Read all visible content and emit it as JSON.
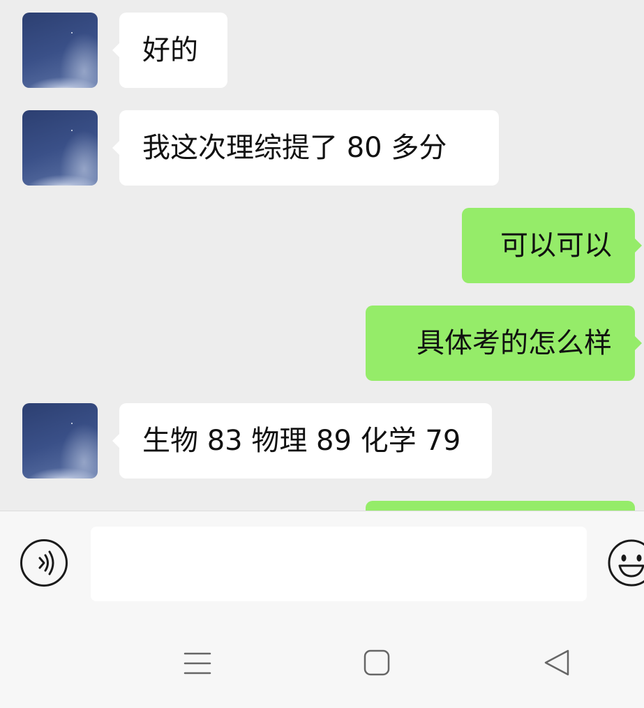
{
  "messages": [
    {
      "side": "in",
      "text": "好的"
    },
    {
      "side": "in",
      "text": "我这次理综提了 80 多分"
    },
    {
      "side": "out",
      "text": "可以可以"
    },
    {
      "side": "out",
      "text": "具体考的怎么样"
    },
    {
      "side": "in",
      "text": "生物 83 物理 89 化学 79"
    },
    {
      "side": "out",
      "text": ""
    }
  ],
  "input_bar": {
    "voice_icon": "voice-icon",
    "emoji_icon": "emoji-icon",
    "text_value": ""
  },
  "nav_bar": {
    "menu_icon": "menu-icon",
    "home_icon": "home-icon",
    "back_icon": "back-icon"
  },
  "colors": {
    "background": "#ededed",
    "incoming_bubble": "#ffffff",
    "outgoing_bubble": "#95ec69",
    "bar": "#f7f7f7"
  }
}
